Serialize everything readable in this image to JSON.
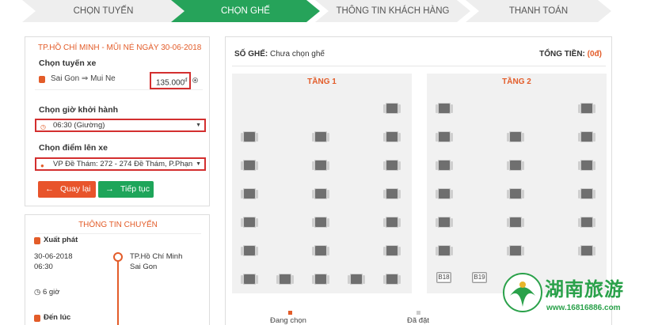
{
  "steps": [
    "CHỌN TUYẾN",
    "CHỌN GHẾ",
    "THÔNG TIN KHÁCH HÀNG",
    "THANH TOÁN"
  ],
  "booking": {
    "route_title": "TP.HỒ CHÍ MINH - MŨI NÉ NGÀY 30-06-2018",
    "route_label": "Chọn tuyến xe",
    "route_name": "Sai Gon ⇒ Mui Ne",
    "price": "135.000",
    "currency": "đ",
    "time_label": "Chọn giờ khởi hành",
    "time_value": "06:30 (Giường)",
    "pickup_label": "Chọn điểm lên xe",
    "pickup_value": "VP Đề Thám: 272 - 274 Đề Thám, P.Phạn",
    "back_label": "Quay lại",
    "next_label": "Tiếp tục"
  },
  "trip": {
    "title": "THÔNG TIN CHUYẾN",
    "depart_label": "Xuất phát",
    "depart_date": "30-06-2018",
    "depart_time": "06:30",
    "depart_city": "TP.Hồ Chí Minh",
    "depart_place": "Sai Gon",
    "duration": "6 giờ",
    "arrive_label": "Đến lúc"
  },
  "seats": {
    "so_ghe_label": "SỐ GHẾ:",
    "so_ghe_value": "Chưa chọn ghế",
    "tong_tien_label": "TỔNG TIỀN:",
    "tong_tien_value": "(0đ)",
    "floor1_title": "TẦNG 1",
    "floor2_title": "TẦNG 2",
    "seat_b18": "B18",
    "seat_b19": "B19",
    "legend_selecting": "Đang chọn",
    "legend_booked": "Đã đặt",
    "legend_selecting_color": "#e35c29",
    "legend_booked_color": "#cccccc"
  },
  "watermark": {
    "cn_text": "湖南旅游",
    "url": "www.16816886.com"
  },
  "colors": {
    "accent_green": "#26a35a",
    "accent_orange": "#e35c29",
    "highlight_red": "#d32f2f"
  }
}
